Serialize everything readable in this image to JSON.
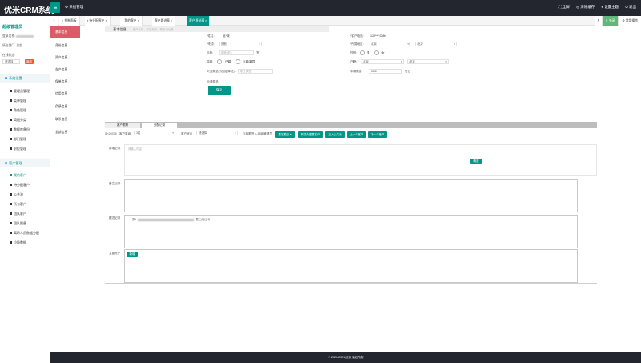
{
  "header": {
    "brand": "优米CRM系统",
    "menu_toggle_icon": "menu-icon",
    "system_menu": "系统管理",
    "right_items": [
      "全屏",
      "清除缓存",
      "设置主题",
      "退出"
    ]
  },
  "sidebar": {
    "title": "超级管理员",
    "account_label": "登录名称:",
    "dept_label": "所在部门:",
    "dept_value": "总部",
    "role_label": "在线状态:",
    "status_value": "请选择",
    "status_button": "离线",
    "group1": "系统设置",
    "group1_items": [
      "管理员管理",
      "菜单管理",
      "角色管理",
      "简报分类",
      "数据库备份",
      "部门管理",
      "职位管理"
    ],
    "group2": "客户管理",
    "group2_items": [
      "我的客户",
      "待分配客户",
      "公共池",
      "所有客户",
      "团队客户",
      "团队报备",
      "离职人员数据分配",
      "垃圾数据"
    ]
  },
  "tabs": {
    "items": [
      "控制面板",
      "待分配客户",
      "我的客户",
      "客户跟进表",
      "客户跟进表"
    ],
    "close_label": "关闭",
    "ops_label": "常用操作"
  },
  "side_tabs": [
    "基本信息",
    "身份信息",
    "资产信息",
    "车产信息",
    "保单信息",
    "信用信息",
    "负债信息",
    "联系信息",
    "全部信息"
  ],
  "basic": {
    "section_title": "基本信息",
    "section_sub": "客户名称、手机号码、联系地址等",
    "name_label": "*姓名:",
    "name_value": "赵*娥",
    "mobile_label": "*客户电话:",
    "mobile_value": "130****2080",
    "source_label": "*来源:",
    "source_value": "其他",
    "region_label": "*所属地区:",
    "region_value1": "北京",
    "region_value2": "北京",
    "age_label": "年龄:",
    "age_placeholder": "年龄(岁)",
    "age_unit": "岁",
    "gender_label": "性别:",
    "gender_male": "男",
    "gender_female": "女",
    "marriage_label": "婚姻:",
    "marriage_married": "已婚",
    "marriage_single": "未婚/离异",
    "hukou_label": "户籍:",
    "hukou_value1": "北京",
    "hukou_value2": "北京",
    "work_label": "职业类型(有固定单位):",
    "work_placeholder": "职业类型",
    "loan_label": "申请额度:",
    "loan_value": "0.00",
    "loan_unit": "万元",
    "apply_type_label": "申请类型:",
    "save_button": "保存"
  },
  "lower": {
    "tab1": "客户跟踪",
    "tab2": "分配记录",
    "id_label": "ID:20376",
    "level_label": "客户星级",
    "level_value": "3星",
    "status_label": "客户状态",
    "status_value": "请选择",
    "assign_label": "当前跟进人:超级管理员",
    "buttons": [
      "报名跟进",
      "转成为重要客户",
      "加入公共池",
      "上一个客户",
      "下一个客户"
    ],
    "new_record_label": "新增记录",
    "new_record_placeholder": "请输入内容",
    "confirm_button": "确定",
    "history_label": "备注记录",
    "follow_label": "跟进记录",
    "follow_text_prefix": "张*",
    "follow_text_suffix": "限二分公司",
    "tail_label": "主要资产",
    "tail_button": "新增"
  },
  "footer": {
    "text": "© 2020-2021 优米 版权所有"
  }
}
